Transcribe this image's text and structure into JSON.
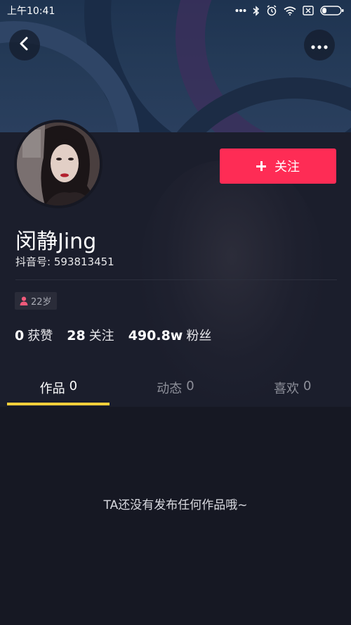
{
  "status_bar": {
    "time": "上午10:41",
    "icons": [
      "more-dots-icon",
      "bluetooth-icon",
      "alarm-icon",
      "wifi-icon",
      "sim-off-icon",
      "battery-icon"
    ]
  },
  "header": {
    "back_icon": "chevron-left-icon",
    "more_icon": "more-dots-icon"
  },
  "profile": {
    "nickname": "闵静Jing",
    "douyin_id": "抖音号: 593813451",
    "age": "22岁",
    "follow_label": "关注"
  },
  "stats": [
    {
      "num": "0",
      "label": "获赞"
    },
    {
      "num": "28",
      "label": "关注"
    },
    {
      "num": "490.8w",
      "label": "粉丝"
    }
  ],
  "tabs": [
    {
      "label": "作品",
      "count": "0",
      "active": true
    },
    {
      "label": "动态",
      "count": "0",
      "active": false
    },
    {
      "label": "喜欢",
      "count": "0",
      "active": false
    }
  ],
  "empty_message": "TA还没有发布任何作品哦~",
  "colors": {
    "accent": "#fe2c55",
    "tab_indicator": "#facf3a",
    "background": "#161823"
  }
}
